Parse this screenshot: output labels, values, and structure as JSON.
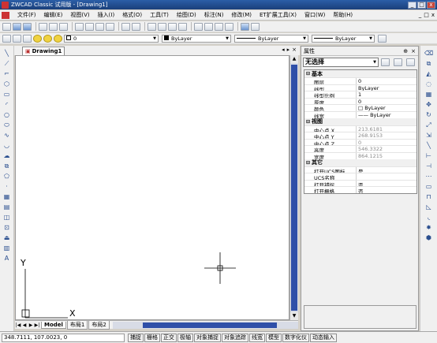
{
  "window": {
    "title": "ZWCAD Classic 试用版 - [Drawing1]",
    "min_glyph": "_",
    "max_glyph": "□",
    "close_glyph": "x"
  },
  "menu": {
    "items": [
      "文件(F)",
      "编辑(E)",
      "视图(V)",
      "插入(I)",
      "格式(O)",
      "工具(T)",
      "绘图(D)",
      "标注(N)",
      "修改(M)",
      "ET扩展工具(X)",
      "窗口(W)",
      "帮助(H)"
    ],
    "mdi_buttons": [
      "_",
      "□",
      "x"
    ]
  },
  "toolbar2": {
    "layer_value": "0",
    "color_value": "ByLayer",
    "linetype_value": "ByLayer",
    "lineweight_value": "ByLayer"
  },
  "doc_tab": {
    "label": "Drawing1",
    "controls": [
      "◂",
      "▸",
      "×"
    ]
  },
  "ucs": {
    "y_label": "Y",
    "x_label": "X"
  },
  "layout_tabs": [
    "Model",
    "布局1",
    "布局2"
  ],
  "properties": {
    "title": "属性",
    "header_controls": [
      "⊕",
      "×"
    ],
    "selection": "无选择",
    "groups": [
      {
        "name": "基本",
        "toggle": "⊟",
        "rows": [
          {
            "key": "图层",
            "value": "0",
            "grey": false
          },
          {
            "key": "线型",
            "value": "ByLayer",
            "grey": false
          },
          {
            "key": "线型比例",
            "value": "1",
            "grey": false
          },
          {
            "key": "厚度",
            "value": "0",
            "grey": false
          },
          {
            "key": "颜色",
            "value": "□ ByLayer",
            "grey": false
          },
          {
            "key": "线宽",
            "value": "—— ByLayer",
            "grey": false
          }
        ]
      },
      {
        "name": "视图",
        "toggle": "⊟",
        "rows": [
          {
            "key": "中心点 X",
            "value": "213.6181",
            "grey": true
          },
          {
            "key": "中心点 Y",
            "value": "268.9153",
            "grey": true
          },
          {
            "key": "中心点 Z",
            "value": "0",
            "grey": true
          },
          {
            "key": "高度",
            "value": "546.3322",
            "grey": true
          },
          {
            "key": "宽度",
            "value": "864.1215",
            "grey": true
          }
        ]
      },
      {
        "name": "其它",
        "toggle": "⊟",
        "rows": [
          {
            "key": "打开UCS图标",
            "value": "是",
            "grey": false
          },
          {
            "key": "UCS名称",
            "value": "",
            "grey": false
          },
          {
            "key": "打开捕捉",
            "value": "否",
            "grey": false
          },
          {
            "key": "打开栅格",
            "value": "否",
            "grey": false
          }
        ]
      }
    ]
  },
  "status": {
    "coords": "348.7111,  107.0023,  0",
    "buttons": [
      "捕捉",
      "栅格",
      "正交",
      "极轴",
      "对象捕捉",
      "对象追踪",
      "线宽",
      "模型",
      "数字化仪",
      "动态输入"
    ]
  },
  "colors": {
    "title_bar": "#1a3f7a",
    "scroll_thumb": "#2f4fa8"
  }
}
